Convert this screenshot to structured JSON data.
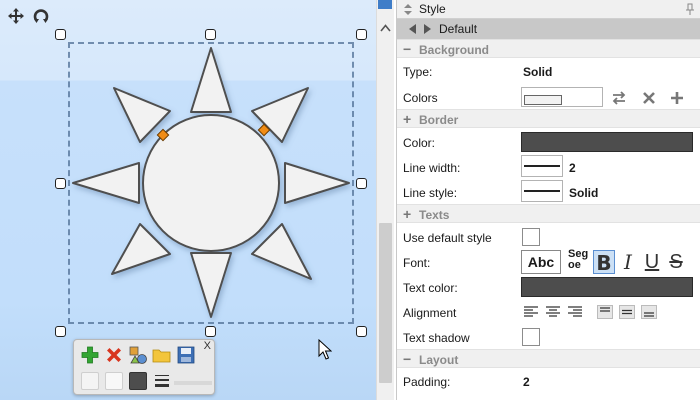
{
  "panel": {
    "title": "Style",
    "nav_label": "Default",
    "sections": {
      "background": "Background",
      "border": "Border",
      "texts": "Texts",
      "layout": "Layout"
    },
    "background": {
      "type_label": "Type:",
      "type_value": "Solid",
      "colors_label": "Colors"
    },
    "border": {
      "color_label": "Color:",
      "line_width_label": "Line width:",
      "line_width_value": "2",
      "line_style_label": "Line style:",
      "line_style_value": "Solid"
    },
    "texts": {
      "use_default_label": "Use default style",
      "font_label": "Font:",
      "font_preview": "Abc",
      "font_name_line1": "Seg",
      "font_name_line2": "oe",
      "text_color_label": "Text color:",
      "alignment_label": "Alignment",
      "text_shadow_label": "Text shadow"
    },
    "layout": {
      "padding_label": "Padding:",
      "padding_value": "2"
    }
  },
  "quick_toolbar": {
    "close_label": "X"
  },
  "colors": {
    "border_color": "#4d4d4d",
    "text_color": "#4d4d4d",
    "accent": "#3f7dc8",
    "selection": "#4f6f95"
  },
  "icons": {
    "move": "move-icon",
    "rotate": "rotate-icon",
    "add": "add-icon",
    "delete": "delete-icon",
    "swap": "swap-icon"
  }
}
